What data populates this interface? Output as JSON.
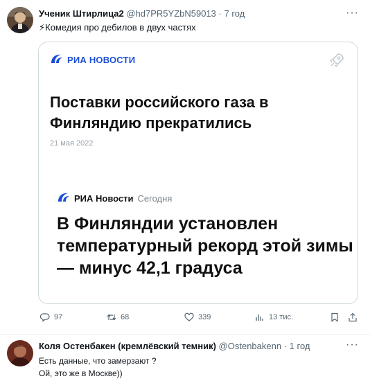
{
  "tweet": {
    "author_name": "Ученик Штирлица2",
    "author_handle": "@hd7PR5YZbN59013",
    "time": "· 7 год",
    "text": "⚡Комедия про дебилов в двух частях",
    "more": "···",
    "card": {
      "top_brand": "РИА НОВОСТИ",
      "headline1": "Поставки российского газа в Финляндию прекратились",
      "date": "21 мая 2022",
      "mid_brand": "РИА Новости",
      "mid_time": "Сегодня",
      "headline2": "В Финляндии установлен температурный рекорд этой зимы — минус 42,1 градуса"
    },
    "actions": {
      "replies": "97",
      "retweets": "68",
      "likes": "339",
      "views": "13 тис."
    }
  },
  "reply": {
    "author_name": "Коля Остенбакен (кремлёвский темник)",
    "author_handle": "@Ostenbakenn",
    "time": "· 1 год",
    "more": "···",
    "line1": "Есть данные, что замерзают ?",
    "line2": "Ой, это же в Москве))"
  },
  "colors": {
    "ria_blue": "#1d4fd8",
    "muted_text": "#536471",
    "border": "#cfd9de"
  },
  "icons": [
    "ria-logo-icon",
    "rocket-icon",
    "reply-icon",
    "retweet-icon",
    "like-icon",
    "views-icon",
    "bookmark-icon",
    "share-icon"
  ]
}
